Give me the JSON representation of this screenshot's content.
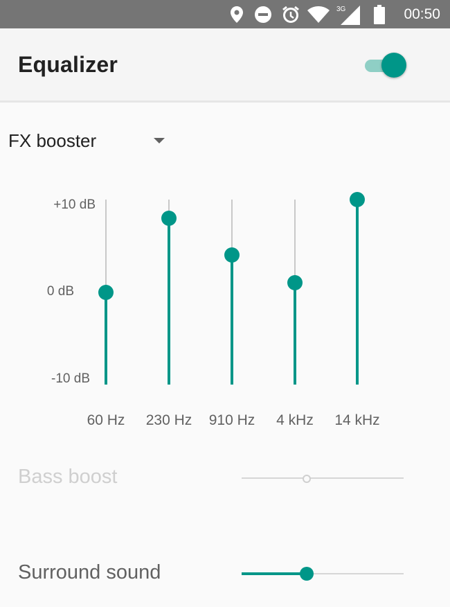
{
  "status_bar": {
    "time": "00:50",
    "icons": [
      "location-icon",
      "do-not-disturb-icon",
      "alarm-icon",
      "wifi-icon",
      "cellular-3g-icon",
      "battery-icon"
    ],
    "network_label": "3G"
  },
  "toolbar": {
    "title": "Equalizer",
    "enabled": true
  },
  "preset": {
    "selected": "FX booster"
  },
  "equalizer": {
    "db_labels": {
      "max": "+10 dB",
      "mid": "0 dB",
      "min": "-10 dB"
    },
    "range_db": [
      -10,
      10
    ],
    "bands": [
      {
        "label": "60 Hz",
        "level_db": 0
      },
      {
        "label": "230 Hz",
        "level_db": 8
      },
      {
        "label": "910 Hz",
        "level_db": 4
      },
      {
        "label": "4 kHz",
        "level_db": 1
      },
      {
        "label": "14 kHz",
        "level_db": 10
      }
    ]
  },
  "effects": {
    "bass_boost": {
      "label": "Bass boost",
      "enabled": false,
      "level": 0.4
    },
    "surround_sound": {
      "label": "Surround sound",
      "enabled": true,
      "level": 0.4
    }
  },
  "colors": {
    "accent": "#009688",
    "status_bar": "#757575",
    "disabled_text": "#cfcfcf"
  }
}
